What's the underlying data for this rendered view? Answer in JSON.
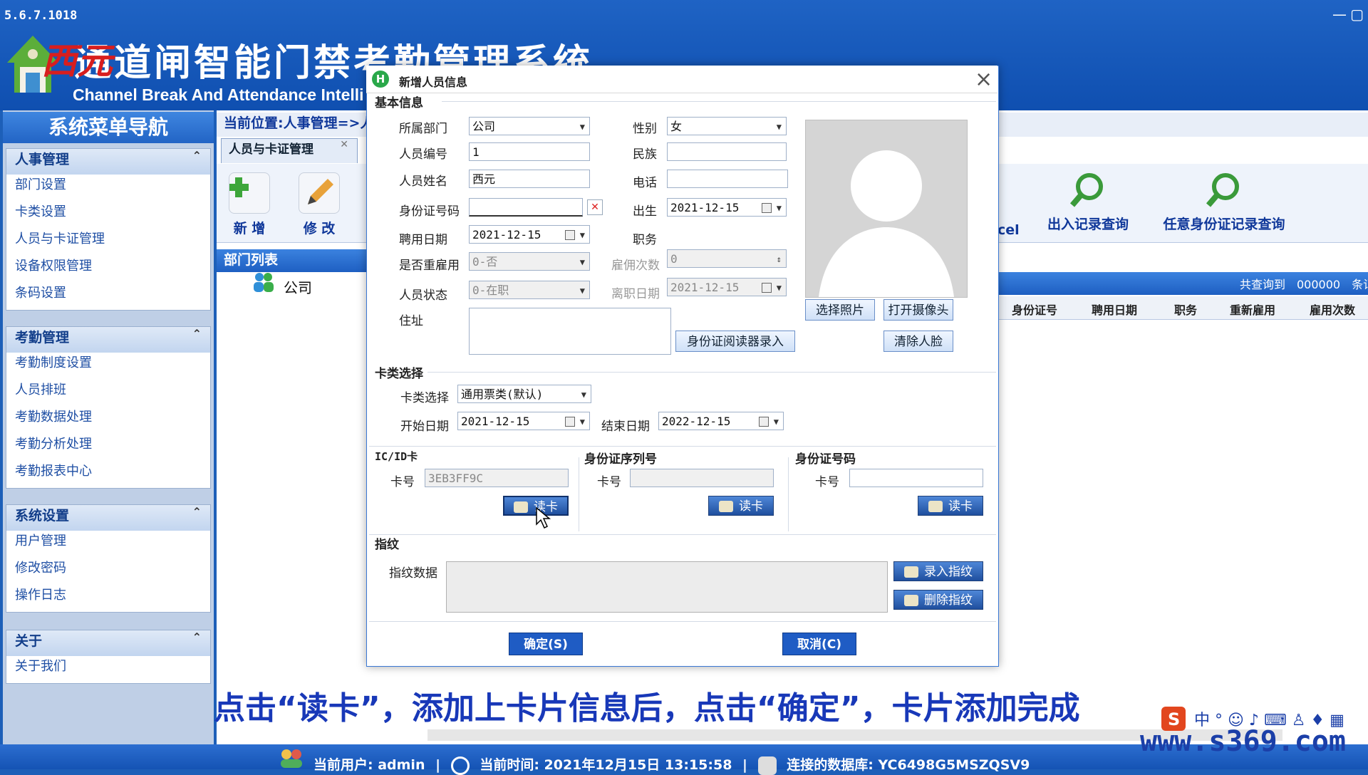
{
  "app": {
    "version": "5.6.7.1018",
    "title": "通道闸智能门禁考勤管理系统",
    "subtitle": "Channel Break And Attendance Intelli",
    "watermark_name": "西元"
  },
  "sidebar": {
    "title": "系统菜单导航",
    "groups": [
      {
        "label": "人事管理",
        "items": [
          "部门设置",
          "卡类设置",
          "人员与卡证管理",
          "设备权限管理",
          "条码设置"
        ]
      },
      {
        "label": "考勤管理",
        "items": [
          "考勤制度设置",
          "人员排班",
          "考勤数据处理",
          "考勤分析处理",
          "考勤报表中心"
        ]
      },
      {
        "label": "系统设置",
        "items": [
          "用户管理",
          "修改密码",
          "操作日志"
        ]
      },
      {
        "label": "关于",
        "items": [
          "关于我们"
        ]
      }
    ]
  },
  "main": {
    "breadcrumb": "当前位置:人事管理=>人",
    "tab_label": "人员与卡证管理",
    "toolbar": {
      "add": "新 增",
      "edit": "修 改",
      "excel_fragment": "cel",
      "access_query": "出入记录查询",
      "id_query": "任意身份证记录查询"
    },
    "dept_list_title": "部门列表",
    "dept_root": "公司",
    "count_text": "共查询到　000000　条记",
    "grid_columns": [
      "身份证号",
      "聘用日期",
      "职务",
      "重新雇用",
      "雇用次数"
    ]
  },
  "dialog": {
    "title": "新增人员信息",
    "basic": {
      "section": "基本信息",
      "dept_label": "所属部门",
      "dept_value": "公司",
      "gender_label": "性别",
      "gender_value": "女",
      "id_label": "人员编号",
      "id_value": "1",
      "ethnic_label": "民族",
      "ethnic_value": "",
      "name_label": "人员姓名",
      "name_value": "西元",
      "phone_label": "电话",
      "phone_value": "",
      "idcard_label": "身份证号码",
      "idcard_value": "",
      "birth_label": "出生",
      "birth_value": "2021-12-15",
      "hire_label": "聘用日期",
      "hire_value": "2021-12-15",
      "post_label": "职务",
      "rehire_label": "是否重雇用",
      "rehire_value": "0-否",
      "hirecount_label": "雇佣次数",
      "hirecount_value": "0",
      "status_label": "人员状态",
      "status_value": "0-在职",
      "leave_label": "离职日期",
      "leave_value": "2021-12-15",
      "address_label": "住址",
      "btn_idreader": "身份证阅读器录入",
      "btn_select_photo": "选择照片",
      "btn_open_camera": "打开摄像头",
      "btn_clear_face": "清除人脸"
    },
    "card": {
      "section": "卡类选择",
      "type_label": "卡类选择",
      "type_value": "通用票类(默认)",
      "start_label": "开始日期",
      "start_value": "2021-12-15",
      "end_label": "结束日期",
      "end_value": "2022-12-15"
    },
    "icid": {
      "section": "IC/ID卡",
      "label": "卡号",
      "value": "3EB3FF9C",
      "btn": "读卡"
    },
    "idserial": {
      "section": "身份证序列号",
      "label": "卡号",
      "value": "",
      "btn": "读卡"
    },
    "idnum": {
      "section": "身份证号码",
      "label": "卡号",
      "value": "",
      "btn": "读卡"
    },
    "fingerprint": {
      "section": "指纹",
      "label": "指纹数据",
      "btn_enroll": "录入指纹",
      "btn_delete": "删除指纹"
    },
    "ok": "确定(S)",
    "cancel": "取消(C)"
  },
  "caption": "点击“读卡”，添加上卡片信息后，点击“确定”，卡片添加完成",
  "status": {
    "user": "当前用户: admin",
    "time": "当前时间: 2021年12月15日 13:15:58",
    "db": "连接的数据库: YC6498G5MSZQSV9"
  },
  "site_watermark": "www.s369.com",
  "colors": {
    "brand_blue": "#1f63c4",
    "dialog_blue": "#1f5cc4",
    "caption_blue": "#1838b8",
    "watermark_red": "#d81e1e"
  }
}
